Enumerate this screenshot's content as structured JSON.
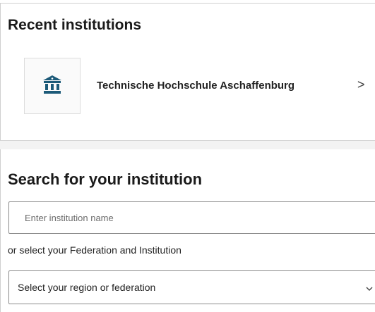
{
  "recent": {
    "title": "Recent institutions",
    "items": [
      {
        "name": "Technische Hochschule Aschaffenburg",
        "icon": "institution-building-icon",
        "chevron": ">"
      }
    ]
  },
  "search": {
    "title": "Search for your institution",
    "input_placeholder": "Enter institution name",
    "input_value": "",
    "or_text": "or select your Federation and Institution",
    "select_label": "Select your region or federation"
  },
  "colors": {
    "icon_teal": "#1c5a78",
    "border": "#8a8a8a",
    "divider_band": "#f3f3f3"
  }
}
